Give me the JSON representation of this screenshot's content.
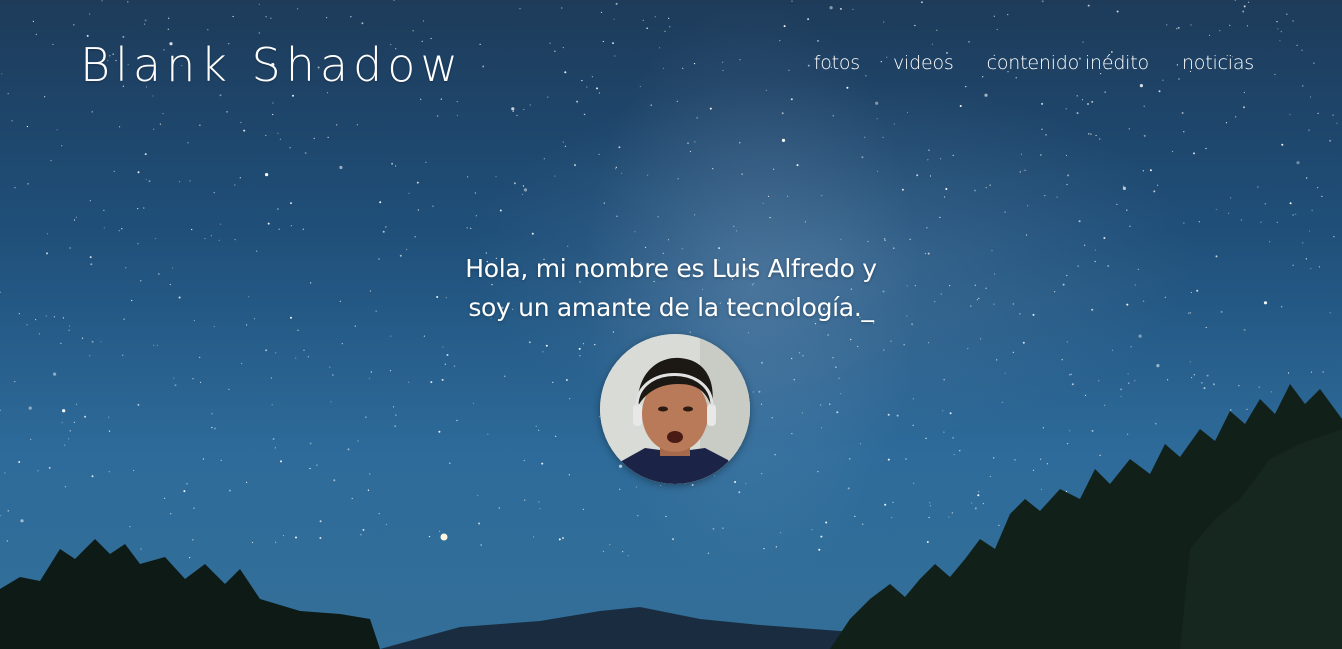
{
  "header": {
    "logo": "Blank Shadow",
    "nav": {
      "fotos": "fotos",
      "videos": "videos",
      "contenido_inedito": "contenido inédito",
      "noticias": "noticias"
    }
  },
  "hero": {
    "line1": "Hola, mi nombre es Luis Alfredo y",
    "line2": "soy un amante de la tecnología._"
  },
  "colors": {
    "sky_top": "#1e3b5a",
    "sky_bottom": "#336f98",
    "text": "#ffffff",
    "trees": "#0c1a14"
  },
  "icons": {
    "avatar": "profile-photo"
  }
}
